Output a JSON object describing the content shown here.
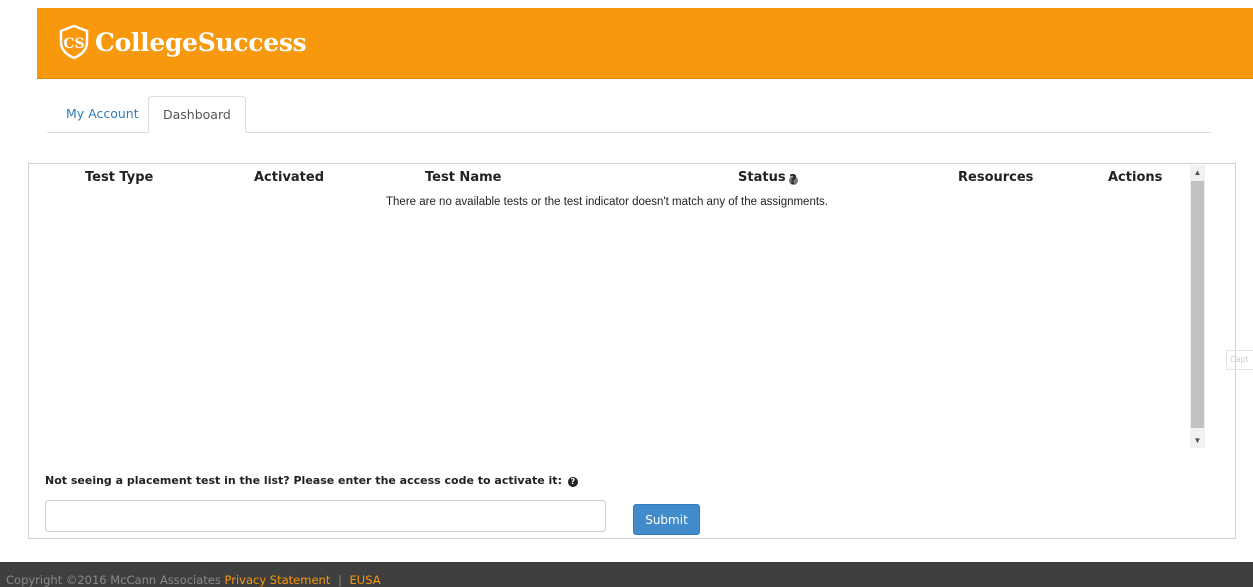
{
  "header": {
    "brand_name": "CollegeSuccess",
    "logo_icon": "shield-cs-logo-icon",
    "brand_color": "#f7980d"
  },
  "tabs": [
    {
      "label": "My Account",
      "active": false
    },
    {
      "label": "Dashboard",
      "active": true
    }
  ],
  "table": {
    "columns": [
      "Test Type",
      "Activated",
      "Test Name",
      "Status",
      "Resources",
      "Actions"
    ],
    "status_help_icon": "question-circle-icon",
    "empty_message": "There are no available tests or the test indicator doesn't match any of the assignments."
  },
  "access_code": {
    "label": "Not seeing a placement test in the list? Please enter the access code to activate it:",
    "help_icon": "question-circle-icon",
    "value": "",
    "placeholder": "",
    "submit_label": "Submit",
    "submit_color": "#428bca"
  },
  "side_tab": {
    "label": "Capt"
  },
  "footer": {
    "copyright": "Copyright ©2016 McCann Associates",
    "privacy_link": "Privacy Statement",
    "separator": "|",
    "eusa_link": "EUSA"
  }
}
